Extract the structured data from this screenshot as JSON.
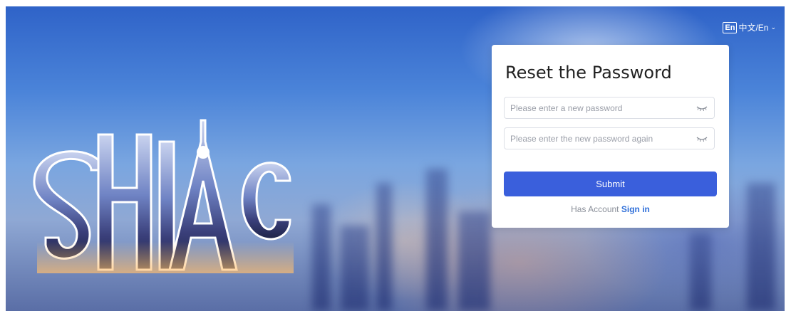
{
  "language_switch": {
    "badge": "En",
    "label": "中文/En",
    "chevron_icon": "chevron-down-icon"
  },
  "logo": {
    "text": "SHIAC"
  },
  "reset_card": {
    "title": "Reset the Password",
    "new_password": {
      "value": "",
      "placeholder": "Please enter a new password",
      "toggle_icon": "eye-closed-icon"
    },
    "confirm_password": {
      "value": "",
      "placeholder": "Please enter the new password again",
      "toggle_icon": "eye-closed-icon"
    },
    "submit_label": "Submit",
    "has_account_text": "Has Account",
    "sign_in_link": "Sign in"
  },
  "colors": {
    "primary_button": "#3a5fdc",
    "link": "#2f6fd9",
    "background_sky": "#2f63c8"
  }
}
